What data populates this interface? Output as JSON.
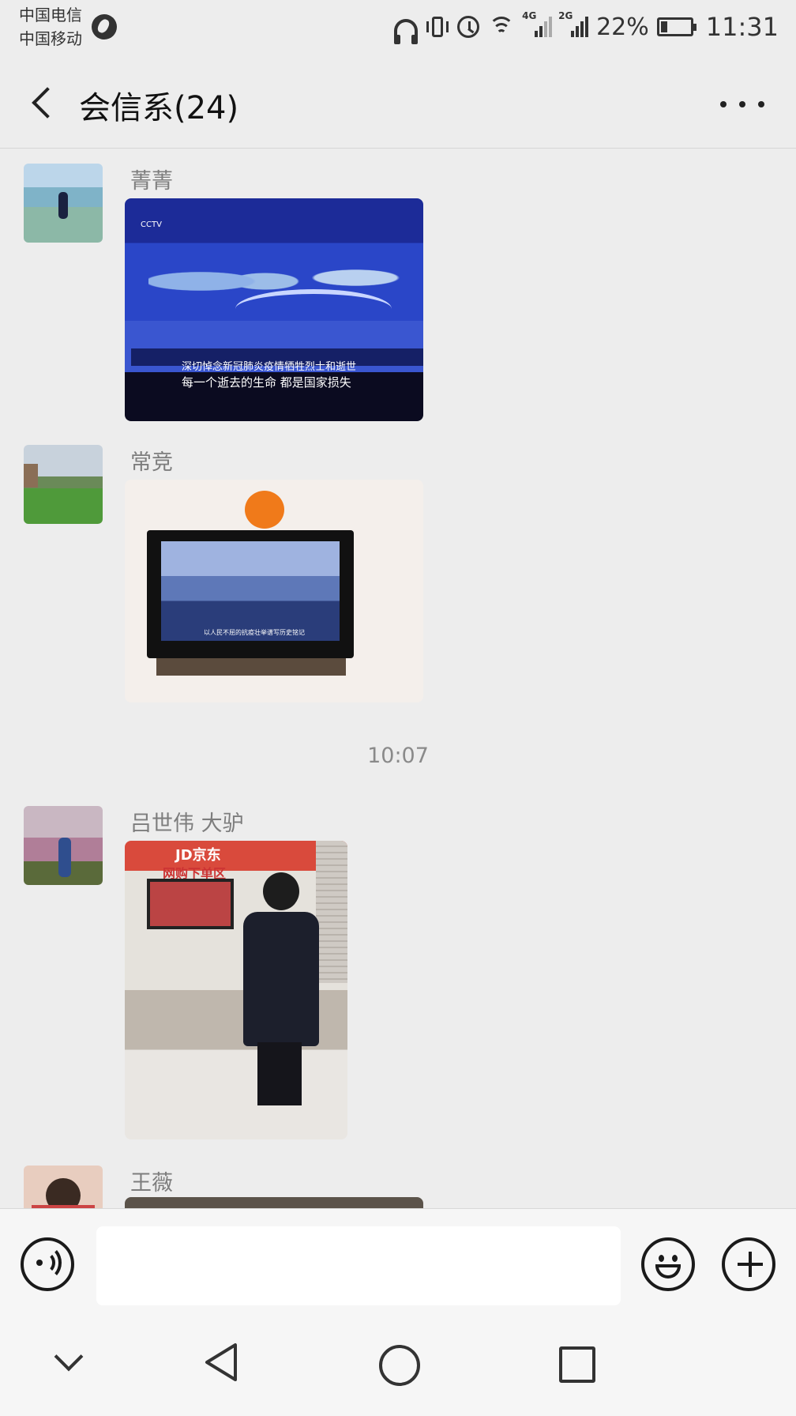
{
  "status_bar": {
    "carrier_1": "中国电信",
    "carrier_2": "中国移动",
    "signal_1_label": "4G",
    "signal_2_label": "2G",
    "battery_percent": "22%",
    "battery_level": 0.22,
    "time": "11:31",
    "icons": [
      "globe-icon",
      "headset-icon",
      "vibrate-icon",
      "alarm-icon",
      "wifi-icon",
      "signal-icon",
      "battery-charging-icon"
    ]
  },
  "header": {
    "title": "会信系(24)",
    "back_icon": "chevron-left-icon",
    "more_icon": "more-dots-icon"
  },
  "messages": [
    {
      "sender": "菁菁",
      "type": "image",
      "avatar": "avatar"
    },
    {
      "sender": "常竞",
      "type": "image",
      "avatar": "avatar"
    },
    {
      "sender": "吕世伟 大驴",
      "type": "image",
      "avatar": "avatar"
    },
    {
      "sender": "王薇",
      "type": "image",
      "avatar": "avatar"
    }
  ],
  "timestamp": "10:07",
  "photo_captions": {
    "tv1_line1": "深切悼念新冠肺炎疫情牺牲烈士和逝世",
    "tv1_line2": "每一个逝去的生命 都是国家损失",
    "tv1_logo": "CCTV",
    "tv2_caption": "以人民不屈的抗疫壮举谱写历史铭记",
    "shop_sign_1": "JD京东",
    "shop_sign_2": "网购下单区"
  },
  "input_bar": {
    "voice_icon": "voice-icon",
    "emoji_icon": "emoji-icon",
    "plus_icon": "plus-icon",
    "text_value": ""
  },
  "nav_bar": {
    "icons": [
      "chevron-down-icon",
      "back-triangle-icon",
      "home-circle-icon",
      "recent-square-icon"
    ]
  }
}
